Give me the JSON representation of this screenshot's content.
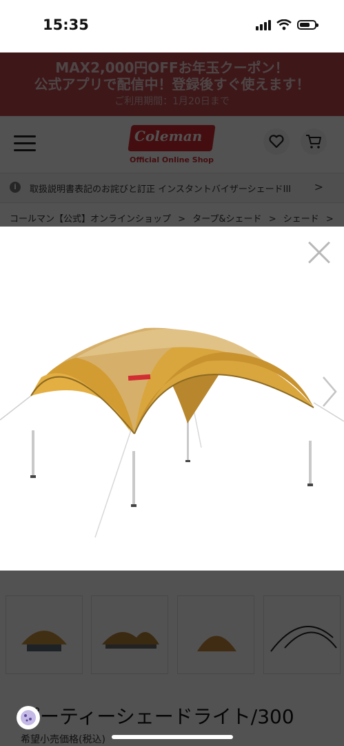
{
  "status_bar": {
    "time": "15:35"
  },
  "promo": {
    "line1": "MAX2,000円OFFお年玉クーポン！",
    "line2": "公式アプリで配信中！登録後すぐ使えます！",
    "line3": "ご利用期間：1月20日まで",
    "color": "#c24a4e"
  },
  "header": {
    "logo_text": "Coleman",
    "logo_sub": "Official Online Shop",
    "brand_color": "#d22d33"
  },
  "notice": {
    "text": "取扱説明書表記のお詫びと訂正 インスタントバイザーシェードIII"
  },
  "breadcrumb": {
    "items": [
      "コールマン【公式】オンラインショップ",
      "タープ&シェード",
      "シェード"
    ]
  },
  "product": {
    "title": "パーティーシェードライト/300",
    "subtitle": "希望小売価格(税込)"
  },
  "modal": {
    "image_name": "party-shade-tent-photo",
    "canopy_color": "#d6a947"
  }
}
